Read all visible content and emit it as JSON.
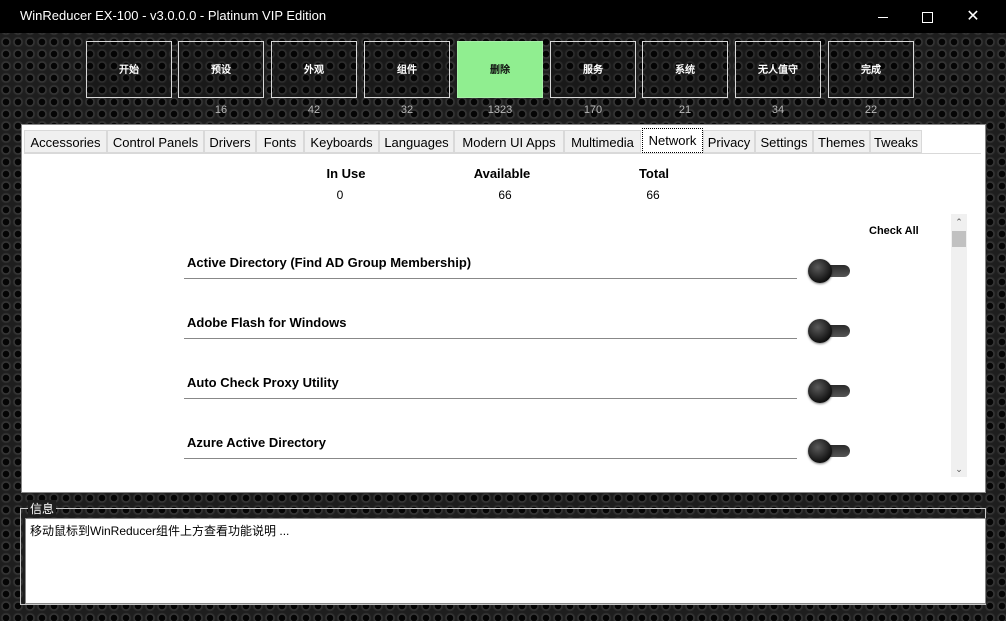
{
  "window": {
    "title": "WinReducer EX-100 - v3.0.0.0 - Platinum VIP Edition",
    "minimize_icon": "minimize-icon",
    "maximize_icon": "maximize-icon",
    "close_icon": "close-icon",
    "close_glyph": "✕"
  },
  "steps": [
    {
      "label": "开始",
      "count": ""
    },
    {
      "label": "预设",
      "count": "16"
    },
    {
      "label": "外观",
      "count": "42"
    },
    {
      "label": "组件",
      "count": "32"
    },
    {
      "label": "删除",
      "count": "1323",
      "active": true
    },
    {
      "label": "服务",
      "count": "170"
    },
    {
      "label": "系统",
      "count": "21"
    },
    {
      "label": "无人值守",
      "count": "34"
    },
    {
      "label": "完成",
      "count": "22"
    }
  ],
  "colors": {
    "active_step": "#90ee90"
  },
  "tabs": [
    "Accessories",
    "Control Panels",
    "Drivers",
    "Fonts",
    "Keyboards",
    "Languages",
    "Modern UI Apps",
    "Multimedia",
    "Network",
    "Privacy",
    "Settings",
    "Themes",
    "Tweaks"
  ],
  "active_tab": "Network",
  "stats": {
    "in_use_label": "In Use",
    "in_use_value": "0",
    "available_label": "Available",
    "available_value": "66",
    "total_label": "Total",
    "total_value": "66"
  },
  "check_all": "Check All",
  "items": [
    {
      "label": "Active Directory (Find AD Group Membership)",
      "enabled": false
    },
    {
      "label": "Adobe Flash for Windows",
      "enabled": false
    },
    {
      "label": "Auto Check Proxy Utility",
      "enabled": false
    },
    {
      "label": "Azure Active Directory",
      "enabled": false
    }
  ],
  "scrollbar": {
    "up_glyph": "⌃",
    "down_glyph": "⌄"
  },
  "info": {
    "title": "信息",
    "text": "移动鼠标到WinReducer组件上方查看功能说明 ..."
  }
}
